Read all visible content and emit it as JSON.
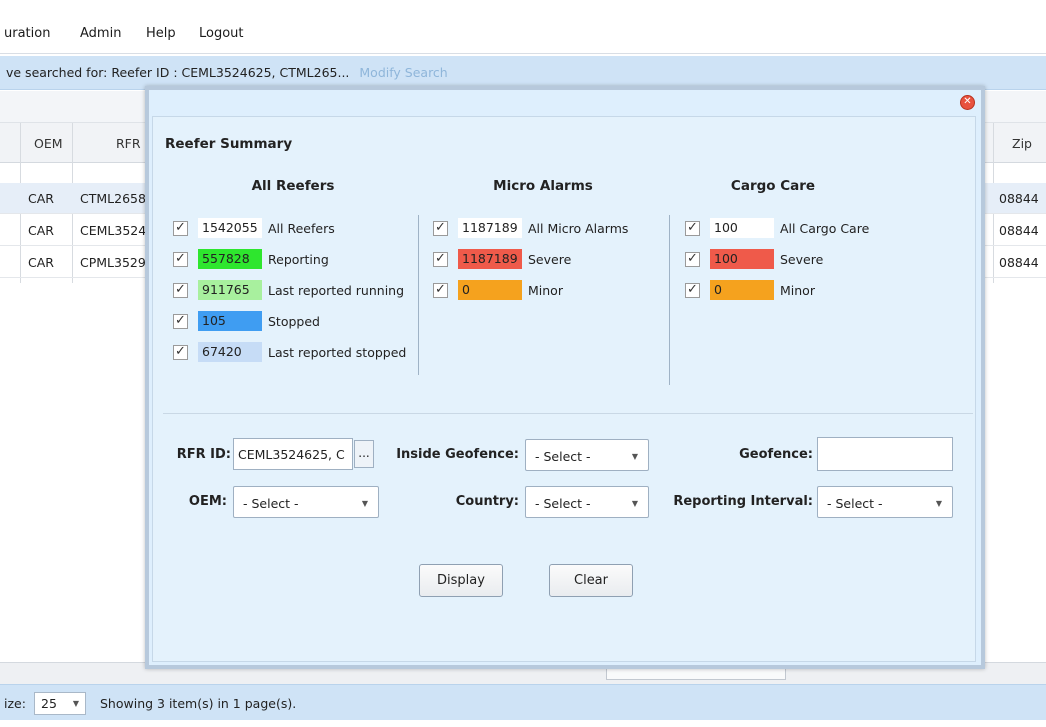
{
  "menu": {
    "items": [
      "uration",
      "Admin",
      "Help",
      "Logout"
    ]
  },
  "search": {
    "text": "ve searched for: Reefer ID : CEML3524625, CTML265...",
    "modify_label": "Modify Search"
  },
  "grid": {
    "headers": {
      "oem": "OEM",
      "rfr": "RFR",
      "zip": "Zip"
    },
    "rows": [
      {
        "oem": "CAR",
        "rfr": "CTML2658",
        "zip": "08844"
      },
      {
        "oem": "CAR",
        "rfr": "CEML3524",
        "zip": "08844"
      },
      {
        "oem": "CAR",
        "rfr": "CPML3529",
        "zip": "08844"
      }
    ]
  },
  "pager": {
    "size_label": "ize:",
    "size_value": "25",
    "info": "Showing 3 item(s) in 1 page(s)."
  },
  "modal": {
    "title": "Reefer Summary",
    "close_icon": "close-icon",
    "columns": [
      {
        "heading": "All Reefers",
        "items": [
          {
            "count": "1542055",
            "label": "All Reefers",
            "color": "#ffffff"
          },
          {
            "count": "557828",
            "label": "Reporting",
            "color": "#2ee62e"
          },
          {
            "count": "911765",
            "label": "Last reported running",
            "color": "#a8f09e"
          },
          {
            "count": "105",
            "label": "Stopped",
            "color": "#3f9df2"
          },
          {
            "count": "67420",
            "label": "Last reported stopped",
            "color": "#c6dcf6"
          }
        ]
      },
      {
        "heading": "Micro Alarms",
        "items": [
          {
            "count": "1187189",
            "label": "All Micro Alarms",
            "color": "#ffffff"
          },
          {
            "count": "1187189",
            "label": "Severe",
            "color": "#ef5a4a"
          },
          {
            "count": "0",
            "label": "Minor",
            "color": "#f5a21e"
          }
        ]
      },
      {
        "heading": "Cargo Care",
        "items": [
          {
            "count": "100",
            "label": "All Cargo Care",
            "color": "#ffffff"
          },
          {
            "count": "100",
            "label": "Severe",
            "color": "#ef5a4a"
          },
          {
            "count": "0",
            "label": "Minor",
            "color": "#f5a21e"
          }
        ]
      }
    ],
    "form": {
      "rfr_id_label": "RFR ID:",
      "rfr_id_value": "CEML3524625, C",
      "dots_label": "...",
      "inside_geofence_label": "Inside Geofence:",
      "inside_geofence_value": "- Select -",
      "geofence_label": "Geofence:",
      "geofence_value": "",
      "oem_label": "OEM:",
      "oem_value": "- Select -",
      "country_label": "Country:",
      "country_value": "- Select -",
      "reporting_interval_label": "Reporting Interval:",
      "reporting_interval_value": "- Select -"
    },
    "buttons": {
      "display": "Display",
      "clear": "Clear"
    }
  }
}
